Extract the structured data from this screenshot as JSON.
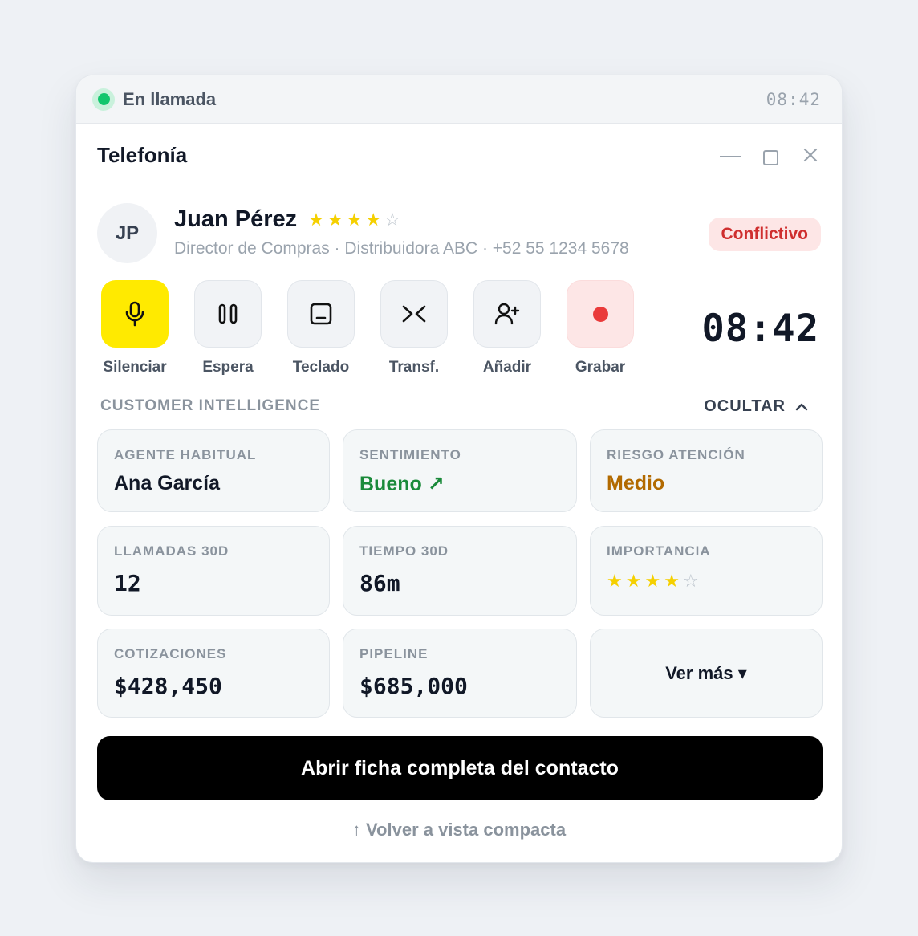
{
  "status": {
    "label": "En llamada",
    "time": "08:42",
    "dot_color": "#12c66d"
  },
  "window": {
    "title": "Telefonía"
  },
  "contact": {
    "initials": "JP",
    "name": "Juan Pérez",
    "rating": 4,
    "rating_max": 5,
    "subtitle": "Director de Compras · Distribuidora ABC · +52 55 1234 5678",
    "badge": "Conflictivo"
  },
  "actions": [
    {
      "label": "Silenciar",
      "icon": "microphone-icon"
    },
    {
      "label": "Espera",
      "icon": "pause-icon"
    },
    {
      "label": "Teclado",
      "icon": "keypad-icon"
    },
    {
      "label": "Transf.",
      "icon": "transfer-icon"
    },
    {
      "label": "Añadir",
      "icon": "add-user-icon"
    },
    {
      "label": "Grabar",
      "icon": "record-icon"
    }
  ],
  "call_timer": "08:42",
  "intelligence": {
    "header": "CUSTOMER INTELLIGENCE",
    "toggle_label": "OCULTAR",
    "cards": {
      "agent": {
        "label": "AGENTE HABITUAL",
        "value": "Ana García"
      },
      "sentiment": {
        "label": "SENTIMIENTO",
        "value": "Bueno ↗"
      },
      "risk": {
        "label": "RIESGO ATENCIÓN",
        "value": "Medio"
      },
      "calls": {
        "label": "LLAMADAS 30D",
        "value": "12"
      },
      "time": {
        "label": "TIEMPO 30D",
        "value": "86m"
      },
      "importance": {
        "label": "IMPORTANCIA",
        "rating": 4,
        "rating_max": 5
      },
      "quotes": {
        "label": "COTIZACIONES",
        "value": "$428,450"
      },
      "pipeline": {
        "label": "PIPELINE",
        "value": "$685,000"
      },
      "more": {
        "label": "Ver más ▾"
      }
    }
  },
  "open_button": "Abrir ficha completa del contacto",
  "back_link": "↑ Volver a vista compacta",
  "colors": {
    "mute_active": "#ffea00",
    "badge_bg": "#fde6e6",
    "badge_text": "#cf2e2e",
    "sentiment_good": "#1a8a3a",
    "risk_medium": "#b26a00",
    "star": "#f5d000"
  }
}
